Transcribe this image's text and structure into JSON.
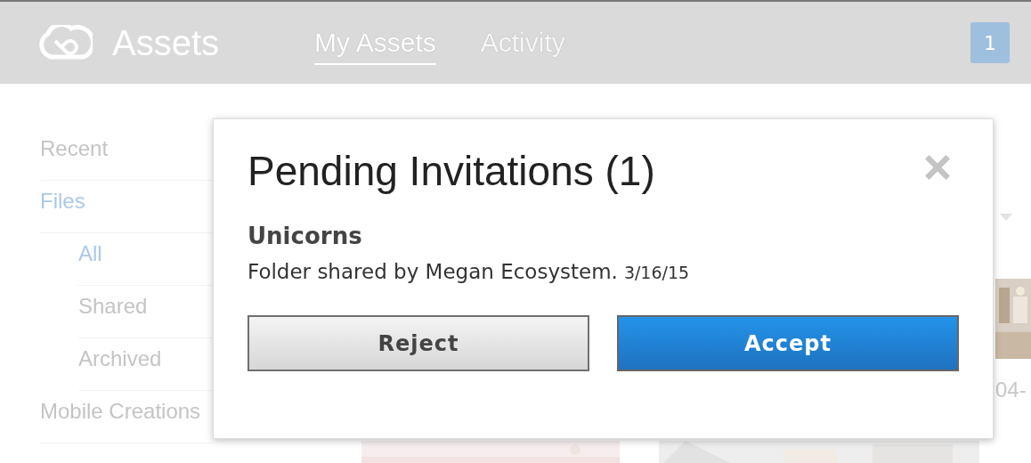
{
  "header": {
    "app_title": "Assets",
    "tabs": [
      {
        "label": "My Assets",
        "selected": true
      },
      {
        "label": "Activity",
        "selected": false
      }
    ],
    "notification_count": "1"
  },
  "sidebar": {
    "items": [
      {
        "label": "Recent",
        "selected": false
      },
      {
        "label": "Files",
        "selected": true,
        "children": [
          {
            "label": "All",
            "selected": true
          },
          {
            "label": "Shared",
            "selected": false
          },
          {
            "label": "Archived",
            "selected": false
          }
        ]
      },
      {
        "label": "Mobile Creations",
        "selected": false
      }
    ]
  },
  "content": {
    "file_caption": "04-"
  },
  "dialog": {
    "title": "Pending Invitations (1)",
    "invitations": [
      {
        "name": "Unicorns",
        "description": "Folder shared by Megan Ecosystem.",
        "date": "3/16/15"
      }
    ],
    "buttons": [
      {
        "label": "Reject",
        "kind": "secondary"
      },
      {
        "label": "Accept",
        "kind": "primary"
      }
    ]
  }
}
